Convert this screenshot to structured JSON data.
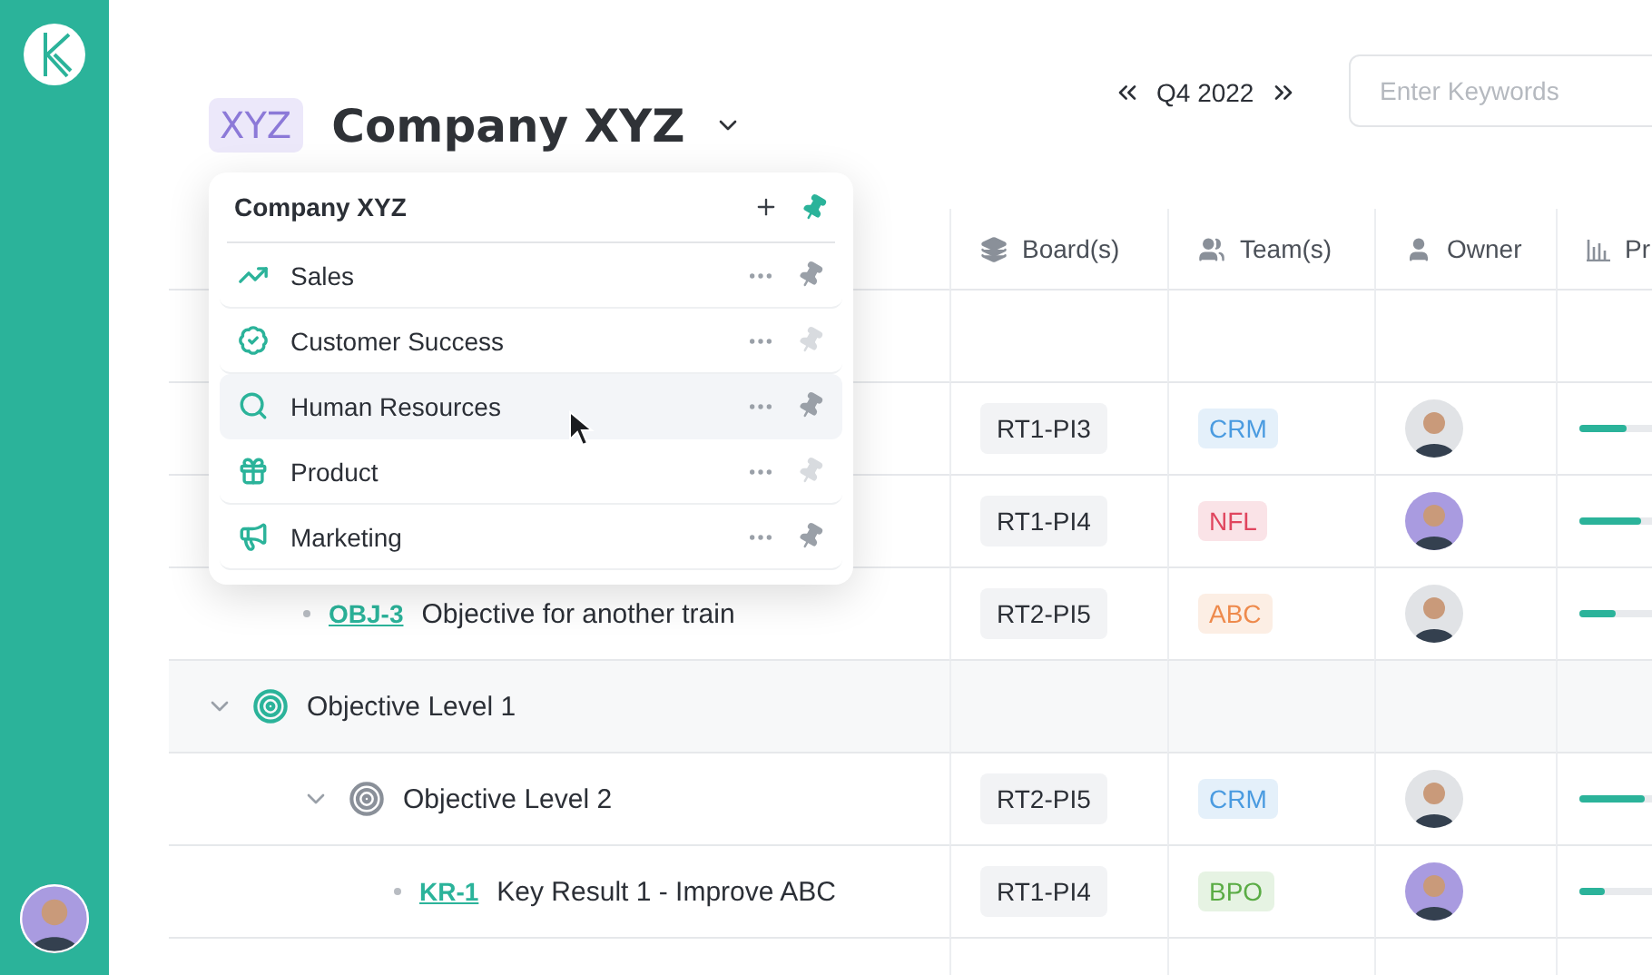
{
  "header": {
    "badge": "XYZ",
    "title": "Company XYZ",
    "period": "Q4 2022",
    "search": {
      "placeholder": "Enter Keywords"
    }
  },
  "dropdown": {
    "title": "Company XYZ",
    "items": [
      {
        "label": "Sales",
        "kind": "sales",
        "selected": false,
        "pinned": true
      },
      {
        "label": "Customer Success",
        "kind": "success",
        "selected": false,
        "pinned": false
      },
      {
        "label": "Human Resources",
        "kind": "people",
        "selected": true,
        "pinned": true
      },
      {
        "label": "Product",
        "kind": "product",
        "selected": false,
        "pinned": false
      },
      {
        "label": "Marketing",
        "kind": "marketing",
        "selected": false,
        "pinned": true
      }
    ]
  },
  "table": {
    "columns": [
      {
        "label": "Board(s)",
        "kind": "board"
      },
      {
        "label": "Team(s)",
        "kind": "team"
      },
      {
        "label": "Owner",
        "kind": "owner"
      },
      {
        "label": "Pr",
        "kind": "progress"
      }
    ],
    "rows": [
      {
        "kind": "group",
        "children": [
          {
            "kind": "item",
            "board": "RT1-PI3",
            "team": "CRM",
            "color": "#4a9be0",
            "level": 0.22
          },
          {
            "kind": "item",
            "board": "RT1-PI4",
            "team": "NFL",
            "color": "#e0455e",
            "level": 0.28
          },
          {
            "kind": "item",
            "id": "OBJ-3",
            "title": "Objective for another train",
            "board": "RT2-PI5",
            "team": "ABC",
            "color": "#ee8a4c",
            "level": 0.17
          }
        ]
      },
      {
        "kind": "objective",
        "title": "Objective Level 1",
        "expanded": true,
        "children": [
          {
            "kind": "objective",
            "title": "Objective Level 2",
            "expanded": true,
            "board": "RT2-PI5",
            "team": "CRM",
            "color": "#4a9be0",
            "level": 0.3,
            "children": [
              {
                "kind": "item",
                "id": "KR-1",
                "title": "Key Result 1 - Improve ABC",
                "board": "RT1-PI4",
                "team": "BPO",
                "color": "#5aac45",
                "level": 0.12
              }
            ]
          }
        ]
      }
    ]
  }
}
